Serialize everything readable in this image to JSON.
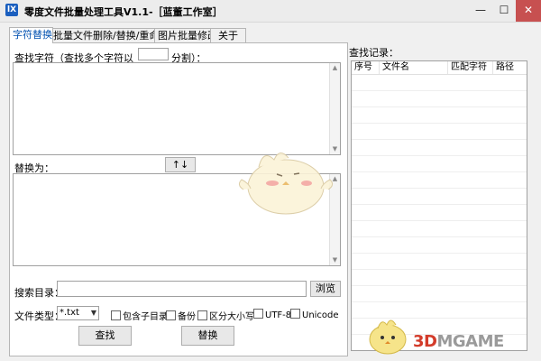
{
  "window": {
    "title": "零度文件批量处理工具V1.1-［蓝董工作室］",
    "icon_glyph": "lX",
    "minimize_glyph": "—",
    "maximize_glyph": "☐",
    "close_glyph": "✕"
  },
  "tabs": [
    {
      "label": "字符替换",
      "active": true
    },
    {
      "label": "批量文件删除/替换/重命名"
    },
    {
      "label": "图片批量修改"
    },
    {
      "label": "关于"
    }
  ],
  "find": {
    "label_prefix": "查找字符（查找多个字符以",
    "separator_value": "",
    "label_suffix": "分割）："
  },
  "replace": {
    "label": "替换为：",
    "swap_label": "↑↓"
  },
  "search_dir": {
    "label": "搜索目录：",
    "value": "",
    "browse_label": "浏览"
  },
  "options": {
    "file_type_label": "文件类型：",
    "file_type_value": "*.txt",
    "include_subdirs": "包含子目录",
    "backup": "备份",
    "case_sensitive": "区分大小写",
    "utf8": "UTF-8",
    "unicode": "Unicode"
  },
  "actions": {
    "find_button": "查找",
    "replace_button": "替换"
  },
  "results": {
    "title": "查找记录：",
    "columns": [
      "序号",
      "文件名",
      "匹配字符",
      "路径"
    ]
  },
  "watermark": {
    "prefix": "3D",
    "text": "MGAME"
  },
  "colors": {
    "accent": "#0050b0",
    "close_button": "#c75050",
    "watermark_red": "#d33b2a"
  }
}
